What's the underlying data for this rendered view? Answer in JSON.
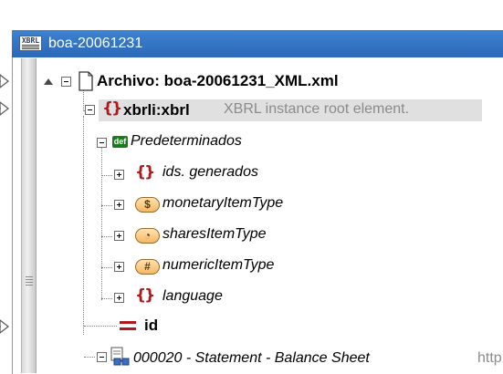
{
  "window": {
    "title": "boa-20061231",
    "icon_label": "XBRL"
  },
  "tree": {
    "file": {
      "label": "Archivo: boa-20061231_XML.xml"
    },
    "root": {
      "label": "xbrli:xbrl",
      "description": "XBRL instance root element."
    },
    "defaults": {
      "badge": "def",
      "label": "Predeterminados"
    },
    "children": [
      {
        "label": "ids. generados",
        "icon": "braces-icon"
      },
      {
        "label": "monetaryItemType",
        "chip": "$"
      },
      {
        "label": "sharesItemType",
        "chip": "◔"
      },
      {
        "label": "numericItemType",
        "chip": "#"
      },
      {
        "label": "language",
        "icon": "braces-icon"
      }
    ],
    "id_attr": {
      "label": "id"
    },
    "statement": {
      "label": "000020 - Statement - Balance Sheet",
      "suffix": "http"
    }
  },
  "colors": {
    "titlebar": "#2c68b8",
    "brace": "#b0181d",
    "def_badge": "#1c7c1c"
  }
}
